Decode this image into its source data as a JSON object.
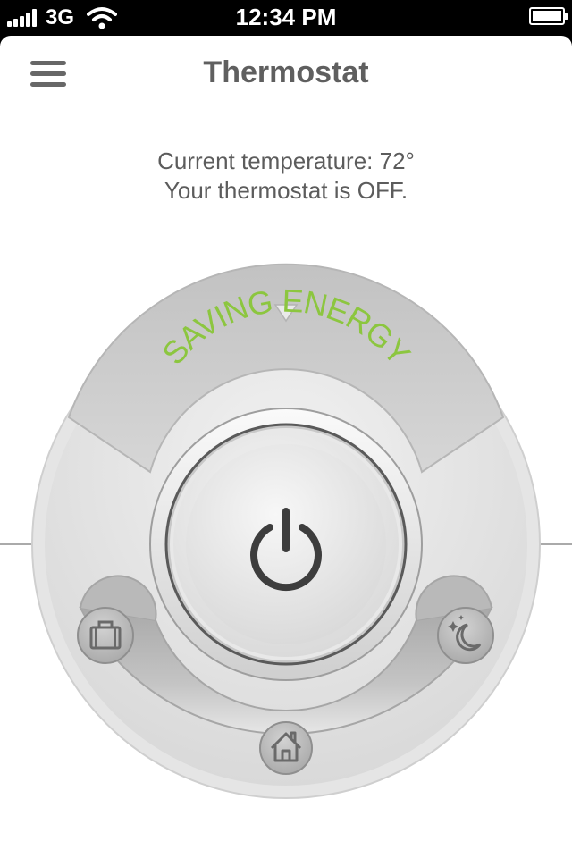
{
  "status_bar": {
    "carrier": "3G",
    "time": "12:34 PM",
    "signal_icon": "signal-bars-icon",
    "wifi_icon": "wifi-icon",
    "battery_icon": "battery-icon"
  },
  "header": {
    "title": "Thermostat",
    "menu_icon": "hamburger-menu-icon"
  },
  "info": {
    "current_temperature": "Current temperature: 72°",
    "status": "Your thermostat is OFF."
  },
  "dial": {
    "mode_label": "SAVING ENERGY",
    "power_icon": "power-icon",
    "modes": [
      {
        "name": "away",
        "icon": "briefcase-icon"
      },
      {
        "name": "home",
        "icon": "house-icon"
      },
      {
        "name": "sleep",
        "icon": "moon-icon"
      }
    ]
  },
  "colors": {
    "accent_green": "#8cc63f",
    "title_gray": "#5f5f5f",
    "power_icon": "#3d3d3d"
  }
}
